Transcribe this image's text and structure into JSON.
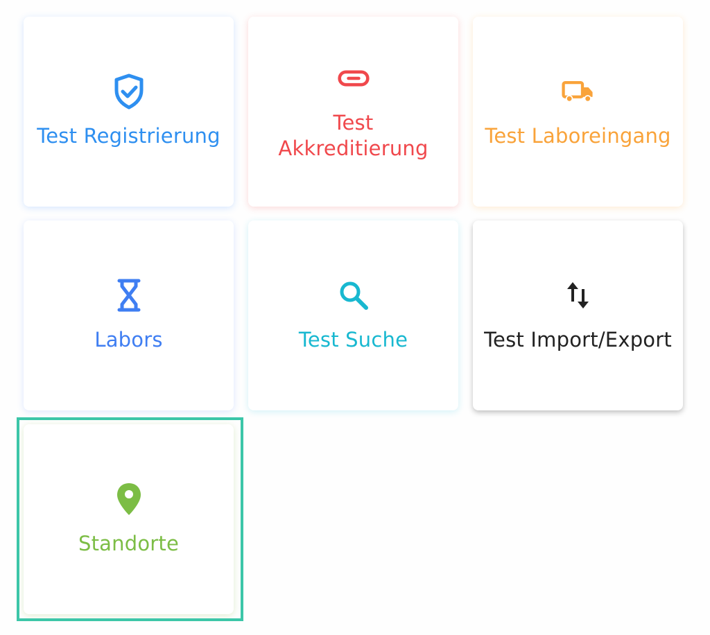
{
  "tiles": [
    {
      "id": "test-registrierung",
      "label": "Test Registrierung",
      "color": "#2e8ff0",
      "icon": "shield-check-icon"
    },
    {
      "id": "test-akkreditierung",
      "label": "Test\nAkkreditierung",
      "color": "#f0484c",
      "icon": "link-icon"
    },
    {
      "id": "test-laboreingang",
      "label": "Test Laboreingang",
      "color": "#f9a33a",
      "icon": "truck-icon"
    },
    {
      "id": "labors",
      "label": "Labors",
      "color": "#3f7ef2",
      "icon": "hourglass-icon"
    },
    {
      "id": "test-suche",
      "label": "Test Suche",
      "color": "#18b8d0",
      "icon": "search-icon"
    },
    {
      "id": "test-import-export",
      "label": "Test Import/Export",
      "color": "#222222",
      "icon": "arrows-up-down-icon"
    },
    {
      "id": "standorte",
      "label": "Standorte",
      "color": "#7cbd45",
      "icon": "location-pin-icon"
    }
  ],
  "focus": {
    "tile": "standorte",
    "ring_color": "#3cc6a8"
  }
}
